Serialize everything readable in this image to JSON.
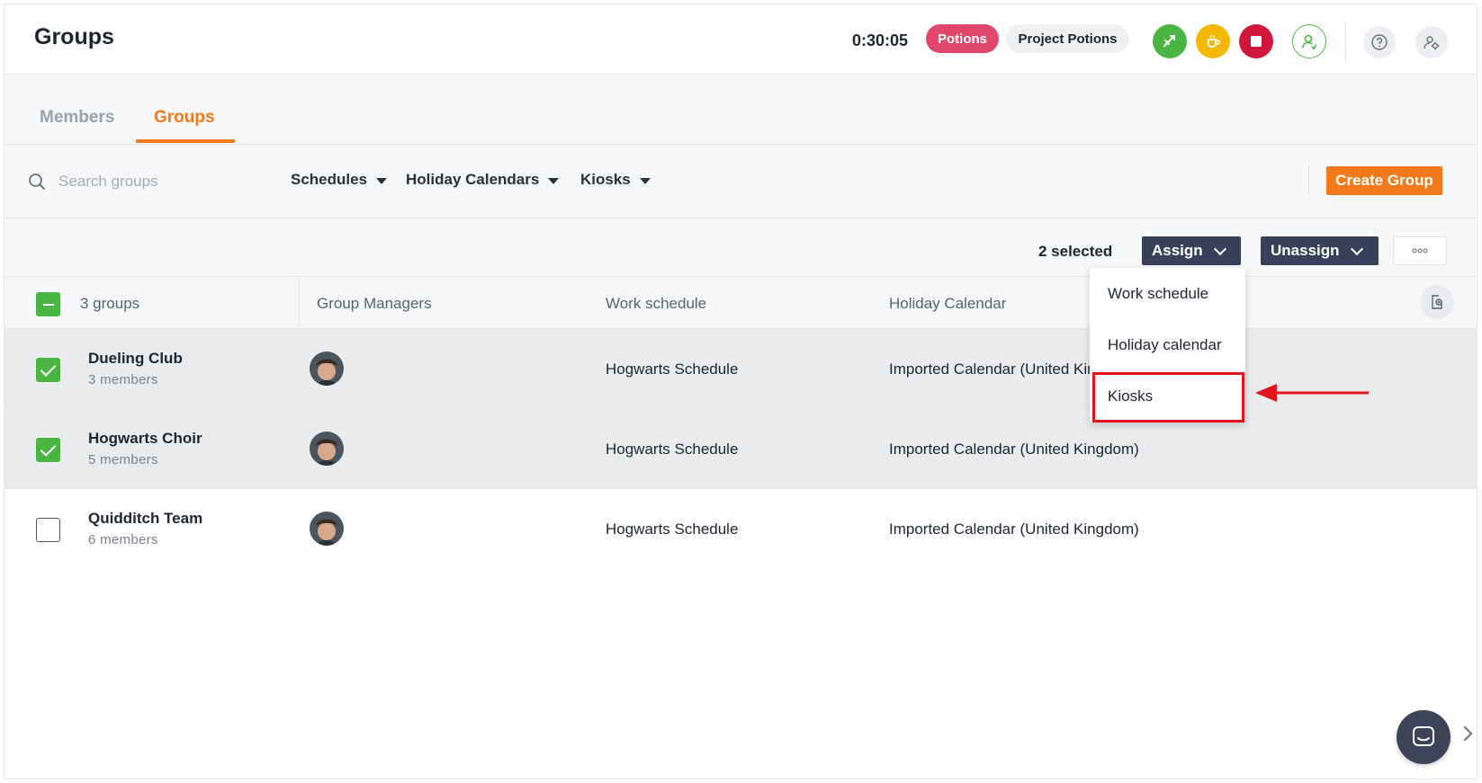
{
  "header": {
    "title": "Groups",
    "timer": "0:30:05",
    "activity_badge": "Potions",
    "project_badge": "Project Potions",
    "accent_colors": {
      "green": "#4bb543",
      "yellow": "#f5b800",
      "red": "#d0173b",
      "orange": "#f27a1a"
    }
  },
  "tabs": [
    {
      "label": "Members",
      "active": false
    },
    {
      "label": "Groups",
      "active": true
    }
  ],
  "filters": {
    "search_placeholder": "Search groups",
    "schedules_label": "Schedules",
    "holiday_label": "Holiday Calendars",
    "kiosks_label": "Kiosks",
    "create_button": "Create Group"
  },
  "actions": {
    "selected_text": "2 selected",
    "assign_label": "Assign",
    "unassign_label": "Unassign",
    "more_icon": "ellipsis-icon"
  },
  "table": {
    "count_label": "3 groups",
    "columns": [
      "Group Managers",
      "Work schedule",
      "Holiday Calendar"
    ],
    "rows": [
      {
        "name": "Dueling Club",
        "members": "3 members",
        "work_schedule": "Hogwarts Schedule",
        "holiday_calendar": "Imported Calendar (United Kingdom)",
        "checked": true
      },
      {
        "name": "Hogwarts Choir",
        "members": "5 members",
        "work_schedule": "Hogwarts Schedule",
        "holiday_calendar": "Imported Calendar (United Kingdom)",
        "checked": true
      },
      {
        "name": "Quidditch Team",
        "members": "6 members",
        "work_schedule": "Hogwarts Schedule",
        "holiday_calendar": "Imported Calendar (United Kingdom)",
        "checked": false
      }
    ]
  },
  "assign_menu": {
    "items": [
      "Work schedule",
      "Holiday calendar",
      "Kiosks"
    ],
    "highlighted": "Kiosks"
  }
}
